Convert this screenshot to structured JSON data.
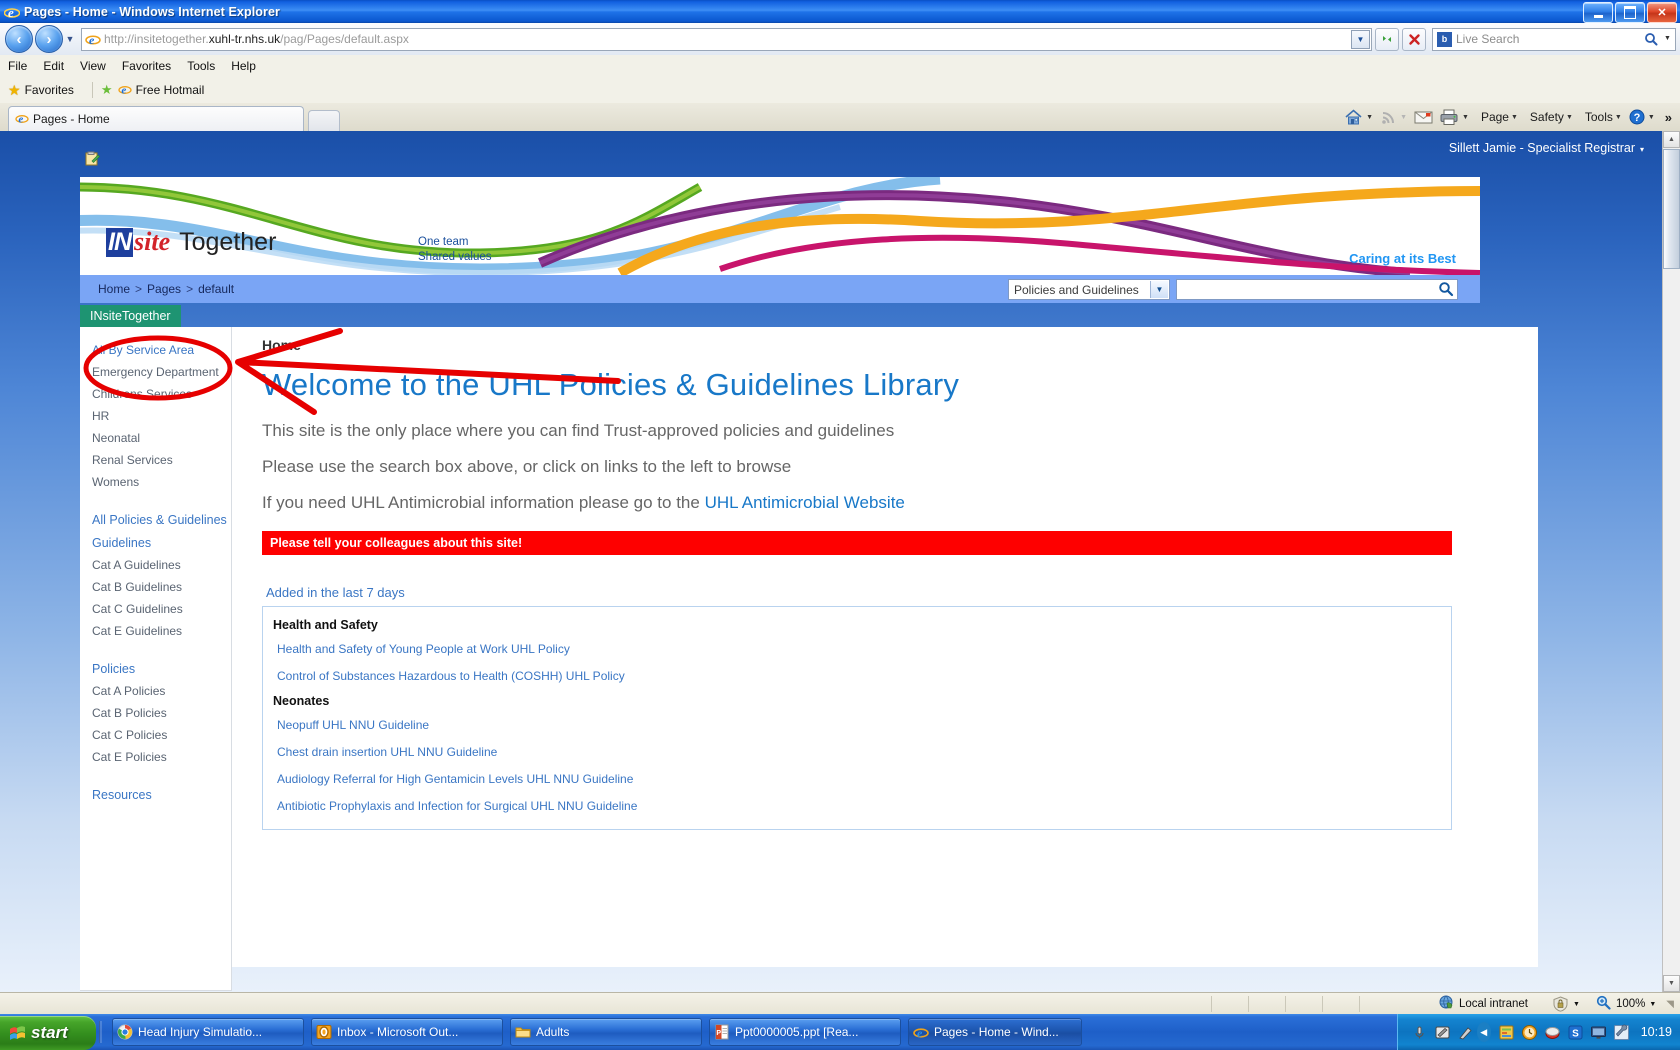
{
  "window": {
    "title": "Pages - Home - Windows Internet Explorer",
    "minimize_label": "_",
    "maximize_label": "❐",
    "close_label": "✕"
  },
  "address_bar": {
    "back_label": "◀",
    "forward_label": "▶",
    "history_caret": "▼",
    "url_scheme": "http://",
    "url_host_pre": "insitetogether.",
    "url_host_main": "xuhl-tr.nhs.uk",
    "url_path": "/pag/Pages/default.aspx",
    "url_full": "http://insitetogether.xuhl-tr.nhs.uk/pag/Pages/default.aspx",
    "autocomplete_caret": "▼",
    "refresh_label": "↻",
    "stop_label": "✕",
    "search_provider": "b",
    "search_placeholder": "Live Search",
    "search_go": "🔍",
    "search_caret": "▼"
  },
  "menu_bar": {
    "items": [
      "File",
      "Edit",
      "View",
      "Favorites",
      "Tools",
      "Help"
    ]
  },
  "favorites_bar": {
    "favorites_label": "Favorites",
    "items": [
      {
        "label": "Free Hotmail"
      }
    ]
  },
  "tabs": [
    {
      "label": "Pages - Home",
      "active": true
    }
  ],
  "command_bar": {
    "home_icon": "home-icon",
    "feeds_icon": "rss-icon",
    "mail_icon": "mail-icon",
    "print_icon": "printer-icon",
    "items": [
      "Page",
      "Safety",
      "Tools"
    ],
    "help_label": "?",
    "overflow_label": "»",
    "caret": "▼"
  },
  "page": {
    "user_bar": {
      "user": "Sillett Jamie - Specialist Registrar",
      "caret": "▾"
    },
    "banner": {
      "logo_in": "IN",
      "logo_site": "site",
      "logo_together": "Together",
      "tagline_line1": "One team",
      "tagline_line2": "Shared values",
      "strapline": "Caring at its Best"
    },
    "breadcrumb": {
      "items": [
        "Home",
        "Pages",
        "default"
      ],
      "separator": ">"
    },
    "search": {
      "scope_selected": "Policies and Guidelines",
      "scope_options": [
        "Policies and Guidelines"
      ],
      "query_value": "",
      "go_icon": "search-icon"
    },
    "site_tab": "INsiteTogether",
    "sidebar": {
      "groups": [
        {
          "items": [
            {
              "label": "All By Service Area",
              "style": "blue"
            },
            {
              "label": "Emergency Department",
              "style": "plain"
            },
            {
              "label": "Childrens Services",
              "style": "plain"
            },
            {
              "label": "HR",
              "style": "plain"
            },
            {
              "label": "Neonatal",
              "style": "plain"
            },
            {
              "label": "Renal Services",
              "style": "plain"
            },
            {
              "label": "Womens",
              "style": "plain"
            }
          ]
        },
        {
          "items": [
            {
              "label": "All Policies & Guidelines",
              "style": "blue"
            },
            {
              "label": "Guidelines",
              "style": "blue"
            },
            {
              "label": "Cat A Guidelines",
              "style": "plain"
            },
            {
              "label": "Cat B Guidelines",
              "style": "plain"
            },
            {
              "label": "Cat C Guidelines",
              "style": "plain"
            },
            {
              "label": "Cat E Guidelines",
              "style": "plain"
            }
          ]
        },
        {
          "items": [
            {
              "label": "Policies",
              "style": "blue"
            },
            {
              "label": "Cat A Policies",
              "style": "plain"
            },
            {
              "label": "Cat B Policies",
              "style": "plain"
            },
            {
              "label": "Cat C Policies",
              "style": "plain"
            },
            {
              "label": "Cat E Policies",
              "style": "plain"
            }
          ]
        },
        {
          "items": [
            {
              "label": "Resources",
              "style": "blue"
            }
          ]
        }
      ]
    },
    "main": {
      "page_label": "Home",
      "heading": "Welcome to the UHL Policies & Guidelines Library",
      "para1": "This site is the only place where you can find Trust-approved policies and guidelines",
      "para2": "Please use the search box above, or click on links to the left to browse",
      "para3_prefix": "If you need UHL Antimicrobial information please go to the ",
      "para3_link": "UHL Antimicrobial Website",
      "red_banner": "Please tell your colleagues about this site!",
      "added_label": "Added in the last 7 days",
      "added_groups": [
        {
          "title": "Health and Safety",
          "links": [
            "Health and Safety of Young People at Work UHL Policy",
            "Control of Substances Hazardous to Health (COSHH) UHL Policy"
          ]
        },
        {
          "title": "Neonates",
          "links": [
            "Neopuff UHL NNU Guideline",
            "Chest drain insertion UHL NNU Guideline",
            "Audiology Referral for High Gentamicin Levels UHL NNU Guideline",
            "Antibiotic Prophylaxis and Infection for Surgical UHL NNU Guideline"
          ]
        }
      ]
    }
  },
  "status_bar": {
    "zone": "Local intranet",
    "protected_icon": "protected-mode-icon",
    "zoom": "100%",
    "caret": "▼"
  },
  "taskbar": {
    "start_label": "start",
    "tasks": [
      {
        "label": "Head Injury Simulatio...",
        "icon": "chrome-icon",
        "active": false
      },
      {
        "label": "Inbox - Microsoft Out...",
        "icon": "outlook-icon",
        "active": false
      },
      {
        "label": "Adults",
        "icon": "folder-icon",
        "active": false
      },
      {
        "label": "Ppt0000005.ppt [Rea...",
        "icon": "powerpoint-icon",
        "active": false
      },
      {
        "label": "Pages - Home - Wind...",
        "icon": "ie-icon",
        "active": true
      }
    ],
    "tray": {
      "show_hidden": "◀",
      "icons": [
        "microphone-icon",
        "tablet-pen-icon",
        "pen-icon",
        "notes-icon",
        "clock-icon",
        "shield-red-icon",
        "sophos-icon",
        "display-icon",
        "tool-icon"
      ],
      "time": "10:19"
    }
  },
  "annotations": {
    "ellipse": "red-ellipse-highlight",
    "arrow": "red-arrow-pointer"
  },
  "colors": {
    "accent_blue": "#1878c8",
    "link_blue": "#3a76c4",
    "nav_strip": "#7aa5f5",
    "site_tab_green": "#1e9472",
    "alert_red": "#fe0000",
    "annotation_red": "#e60000"
  }
}
